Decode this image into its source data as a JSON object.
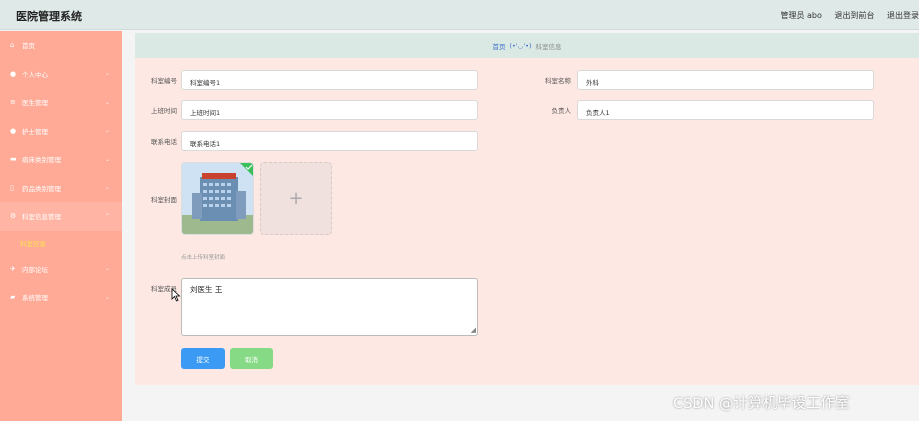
{
  "header": {
    "app_title": "医院管理系统",
    "admin_label": "管理员 abo",
    "front_link": "退出到前台",
    "logout": "退出登录"
  },
  "sidebar": {
    "items": [
      {
        "label": "首页",
        "icon": "home-icon"
      },
      {
        "label": "个人中心",
        "icon": "user-icon"
      },
      {
        "label": "医生管理",
        "icon": "list-icon"
      },
      {
        "label": "护士管理",
        "icon": "user-icon"
      },
      {
        "label": "病床类别管理",
        "icon": "bed-icon"
      },
      {
        "label": "药品类别管理",
        "icon": "phone-icon"
      },
      {
        "label": "科室信息管理",
        "icon": "gear-icon",
        "sub": "科室信息"
      },
      {
        "label": "内部论坛",
        "icon": "forum-icon"
      },
      {
        "label": "系统管理",
        "icon": "system-icon"
      }
    ]
  },
  "breadcrumb": {
    "home": "首页",
    "separator": "(•'◡'•)",
    "current": "科室信息"
  },
  "form": {
    "dept_no": {
      "label": "科室编号",
      "value": "科室编号1"
    },
    "dept_name": {
      "label": "科室名称",
      "value": "外科"
    },
    "work_time": {
      "label": "上班时间",
      "value": "上班时间1"
    },
    "leader": {
      "label": "负责人",
      "value": "负责人1"
    },
    "phone": {
      "label": "联系电话",
      "value": "联系电话1"
    },
    "cover": {
      "label": "科室封面",
      "hint": "点击上传科室封面",
      "plus": "+"
    },
    "members": {
      "label": "科室成员",
      "value": "刘医生 王"
    },
    "submit": "提交",
    "cancel": "取消"
  },
  "watermark": "CSDN @计算机毕设工作室"
}
